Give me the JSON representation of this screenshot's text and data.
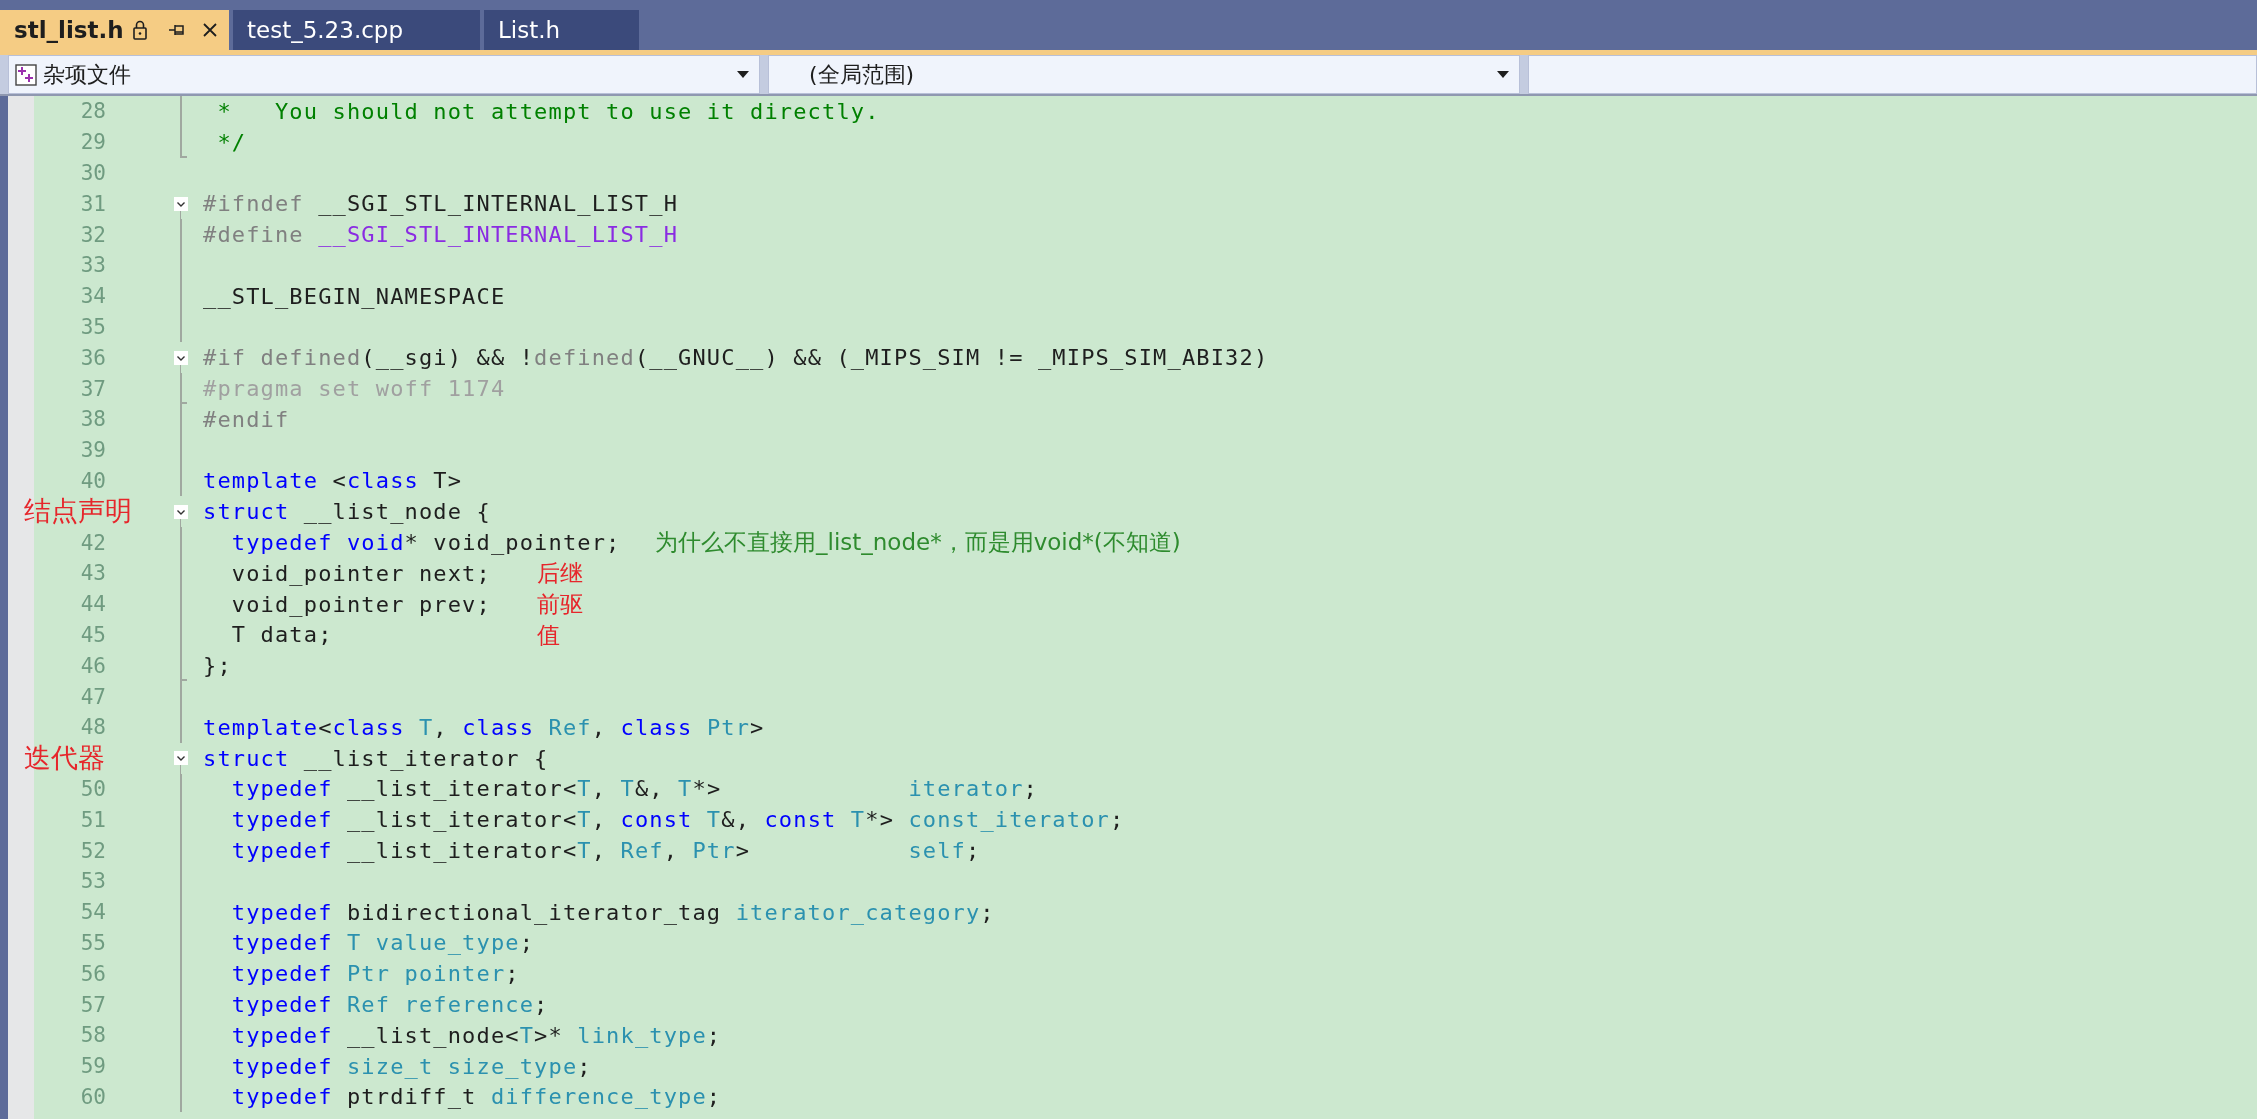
{
  "tabs": [
    {
      "label": "stl_list.h",
      "selected": true,
      "locked": true,
      "pinnable": true,
      "closable": true
    },
    {
      "label": "test_5.23.cpp",
      "selected": false,
      "locked": false,
      "pinnable": false,
      "closable": false
    },
    {
      "label": "List.h",
      "selected": false,
      "locked": false,
      "pinnable": false,
      "closable": false
    }
  ],
  "navigation": [
    {
      "kind": "project",
      "value": "杂项文件"
    },
    {
      "kind": "scope",
      "value": "(全局范围)"
    },
    {
      "kind": "member"
    }
  ],
  "editor": {
    "lines": [
      {
        "number": "28",
        "foldable": false,
        "guide": true,
        "fold_end": false,
        "code": [
          {
            "text": " *   You should not attempt to use it directly.",
            "kind": "comment"
          }
        ]
      },
      {
        "number": "29",
        "foldable": false,
        "guide": true,
        "fold_end": true,
        "code": [
          {
            "text": " */",
            "kind": "comment"
          }
        ]
      },
      {
        "number": "30",
        "foldable": false,
        "guide": false,
        "fold_end": false
      },
      {
        "number": "31",
        "foldable": true,
        "guide": false,
        "fold_end": false,
        "code": [
          {
            "text": "#ifndef",
            "kind": "preproc"
          },
          {
            "text": " __SGI_STL_INTERNAL_LIST_H",
            "kind": "plain"
          }
        ]
      },
      {
        "number": "32",
        "foldable": false,
        "guide": true,
        "fold_end": false,
        "code": [
          {
            "text": "#define",
            "kind": "preproc"
          },
          {
            "text": " __SGI_STL_INTERNAL_LIST_H",
            "kind": "macro"
          }
        ]
      },
      {
        "number": "33",
        "foldable": false,
        "guide": true,
        "fold_end": false
      },
      {
        "number": "34",
        "foldable": false,
        "guide": true,
        "fold_end": false,
        "code": [
          {
            "text": "__STL_BEGIN_NAMESPACE",
            "kind": "plain"
          }
        ]
      },
      {
        "number": "35",
        "foldable": false,
        "guide": true,
        "fold_end": false
      },
      {
        "number": "36",
        "foldable": true,
        "guide": false,
        "fold_end": false,
        "code": [
          {
            "text": "#if defined",
            "kind": "preproc"
          },
          {
            "text": "(__sgi) && !",
            "kind": "plain"
          },
          {
            "text": "defined",
            "kind": "preproc"
          },
          {
            "text": "(__GNUC__) && (_MIPS_SIM != _MIPS_SIM_ABI32)",
            "kind": "plain"
          }
        ]
      },
      {
        "number": "37",
        "foldable": false,
        "guide": true,
        "fold_end": true,
        "code": [
          {
            "text": "#pragma set woff 1174",
            "kind": "inactive"
          }
        ]
      },
      {
        "number": "38",
        "foldable": false,
        "guide": true,
        "fold_end": false,
        "code": [
          {
            "text": "#endif",
            "kind": "preproc"
          }
        ]
      },
      {
        "number": "39",
        "foldable": false,
        "guide": true,
        "fold_end": false
      },
      {
        "number": "40",
        "foldable": false,
        "guide": true,
        "fold_end": false,
        "code": [
          {
            "text": "template",
            "kind": "keyword"
          },
          {
            "text": " <",
            "kind": "plain"
          },
          {
            "text": "class",
            "kind": "keyword"
          },
          {
            "text": " T>",
            "kind": "plain"
          }
        ]
      },
      {
        "margin_note": "结点声明",
        "foldable": true,
        "guide": false,
        "fold_end": false,
        "code": [
          {
            "text": "struct",
            "kind": "keyword"
          },
          {
            "text": " __list_node {",
            "kind": "plain"
          }
        ]
      },
      {
        "number": "42",
        "foldable": false,
        "guide": true,
        "fold_end": false,
        "code": [
          {
            "text": "  typedef void",
            "kind": "keyword"
          },
          {
            "text": "* void_pointer;",
            "kind": "plain"
          }
        ],
        "note": {
          "text": "为什么不直接用_list_node*，而是用void*(不知道)",
          "kind": "comment"
        }
      },
      {
        "number": "43",
        "foldable": false,
        "guide": true,
        "fold_end": false,
        "code": [
          {
            "text": "  void_pointer next;",
            "kind": "plain"
          }
        ],
        "note": {
          "text": "后继",
          "kind": "annotation"
        }
      },
      {
        "number": "44",
        "foldable": false,
        "guide": true,
        "fold_end": false,
        "code": [
          {
            "text": "  void_pointer prev;",
            "kind": "plain"
          }
        ],
        "note": {
          "text": "前驱",
          "kind": "annotation"
        }
      },
      {
        "number": "45",
        "foldable": false,
        "guide": true,
        "fold_end": false,
        "code": [
          {
            "text": "  T data;",
            "kind": "plain"
          }
        ],
        "note": {
          "text": "值",
          "kind": "annotation"
        }
      },
      {
        "number": "46",
        "foldable": false,
        "guide": true,
        "fold_end": true,
        "code": [
          {
            "text": "};",
            "kind": "plain"
          }
        ]
      },
      {
        "number": "47",
        "foldable": false,
        "guide": true,
        "fold_end": false
      },
      {
        "number": "48",
        "foldable": false,
        "guide": true,
        "fold_end": false,
        "code": [
          {
            "text": "template",
            "kind": "keyword"
          },
          {
            "text": "<",
            "kind": "plain"
          },
          {
            "text": "class",
            "kind": "keyword"
          },
          {
            "text": " T",
            "kind": "type"
          },
          {
            "text": ", ",
            "kind": "plain"
          },
          {
            "text": "class",
            "kind": "keyword"
          },
          {
            "text": " Ref",
            "kind": "type"
          },
          {
            "text": ", ",
            "kind": "plain"
          },
          {
            "text": "class",
            "kind": "keyword"
          },
          {
            "text": " Ptr",
            "kind": "type"
          },
          {
            "text": ">",
            "kind": "plain"
          }
        ]
      },
      {
        "margin_note": "迭代器",
        "foldable": true,
        "guide": false,
        "fold_end": false,
        "code": [
          {
            "text": "struct",
            "kind": "keyword"
          },
          {
            "text": " __list_iterator {",
            "kind": "plain"
          }
        ]
      },
      {
        "number": "50",
        "foldable": false,
        "guide": true,
        "fold_end": false,
        "code": [
          {
            "text": "  typedef",
            "kind": "keyword"
          },
          {
            "text": " __list_iterator<",
            "kind": "plain"
          },
          {
            "text": "T",
            "kind": "type"
          },
          {
            "text": ", ",
            "kind": "plain"
          },
          {
            "text": "T",
            "kind": "type"
          },
          {
            "text": "&, ",
            "kind": "plain"
          },
          {
            "text": "T",
            "kind": "type"
          },
          {
            "text": "*>             ",
            "kind": "plain"
          },
          {
            "text": "iterator",
            "kind": "type"
          },
          {
            "text": ";",
            "kind": "plain"
          }
        ]
      },
      {
        "number": "51",
        "foldable": false,
        "guide": true,
        "fold_end": false,
        "code": [
          {
            "text": "  typedef",
            "kind": "keyword"
          },
          {
            "text": " __list_iterator<",
            "kind": "plain"
          },
          {
            "text": "T",
            "kind": "type"
          },
          {
            "text": ", ",
            "kind": "plain"
          },
          {
            "text": "const",
            "kind": "keyword"
          },
          {
            "text": " T",
            "kind": "type"
          },
          {
            "text": "&, ",
            "kind": "plain"
          },
          {
            "text": "const",
            "kind": "keyword"
          },
          {
            "text": " T",
            "kind": "type"
          },
          {
            "text": "*> ",
            "kind": "plain"
          },
          {
            "text": "const_iterator",
            "kind": "type"
          },
          {
            "text": ";",
            "kind": "plain"
          }
        ]
      },
      {
        "number": "52",
        "foldable": false,
        "guide": true,
        "fold_end": false,
        "code": [
          {
            "text": "  typedef",
            "kind": "keyword"
          },
          {
            "text": " __list_iterator<",
            "kind": "plain"
          },
          {
            "text": "T",
            "kind": "type"
          },
          {
            "text": ", ",
            "kind": "plain"
          },
          {
            "text": "Ref",
            "kind": "type"
          },
          {
            "text": ", ",
            "kind": "plain"
          },
          {
            "text": "Ptr",
            "kind": "type"
          },
          {
            "text": ">           ",
            "kind": "plain"
          },
          {
            "text": "self",
            "kind": "type"
          },
          {
            "text": ";",
            "kind": "plain"
          }
        ]
      },
      {
        "number": "53",
        "foldable": false,
        "guide": true,
        "fold_end": false
      },
      {
        "number": "54",
        "foldable": false,
        "guide": true,
        "fold_end": false,
        "code": [
          {
            "text": "  typedef",
            "kind": "keyword"
          },
          {
            "text": " bidirectional_iterator_tag ",
            "kind": "plain"
          },
          {
            "text": "iterator_category",
            "kind": "type"
          },
          {
            "text": ";",
            "kind": "plain"
          }
        ]
      },
      {
        "number": "55",
        "foldable": false,
        "guide": true,
        "fold_end": false,
        "code": [
          {
            "text": "  typedef",
            "kind": "keyword"
          },
          {
            "text": " T value_type",
            "kind": "type"
          },
          {
            "text": ";",
            "kind": "plain"
          }
        ]
      },
      {
        "number": "56",
        "foldable": false,
        "guide": true,
        "fold_end": false,
        "code": [
          {
            "text": "  typedef",
            "kind": "keyword"
          },
          {
            "text": " Ptr pointer",
            "kind": "type"
          },
          {
            "text": ";",
            "kind": "plain"
          }
        ]
      },
      {
        "number": "57",
        "foldable": false,
        "guide": true,
        "fold_end": false,
        "code": [
          {
            "text": "  typedef",
            "kind": "keyword"
          },
          {
            "text": " Ref reference",
            "kind": "type"
          },
          {
            "text": ";",
            "kind": "plain"
          }
        ]
      },
      {
        "number": "58",
        "foldable": false,
        "guide": true,
        "fold_end": false,
        "code": [
          {
            "text": "  typedef",
            "kind": "keyword"
          },
          {
            "text": " __list_node<",
            "kind": "plain"
          },
          {
            "text": "T",
            "kind": "type"
          },
          {
            "text": ">* ",
            "kind": "plain"
          },
          {
            "text": "link_type",
            "kind": "type"
          },
          {
            "text": ";",
            "kind": "plain"
          }
        ]
      },
      {
        "number": "59",
        "foldable": false,
        "guide": true,
        "fold_end": false,
        "code": [
          {
            "text": "  typedef",
            "kind": "keyword"
          },
          {
            "text": " size_t size_type",
            "kind": "type"
          },
          {
            "text": ";",
            "kind": "plain"
          }
        ]
      },
      {
        "number": "60",
        "foldable": false,
        "guide": true,
        "fold_end": false,
        "code": [
          {
            "text": "  typedef",
            "kind": "keyword"
          },
          {
            "text": " ptrdiff_t ",
            "kind": "plain"
          },
          {
            "text": "difference_type",
            "kind": "type"
          },
          {
            "text": ";",
            "kind": "plain"
          }
        ]
      }
    ]
  }
}
